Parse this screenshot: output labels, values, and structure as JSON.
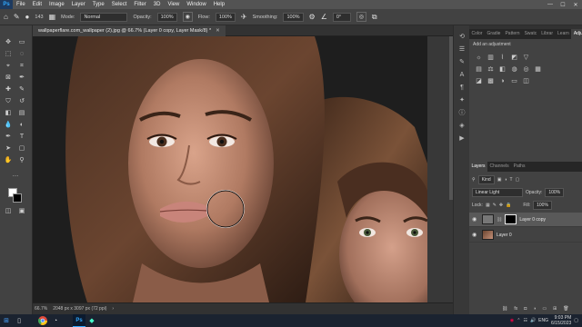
{
  "menubar": {
    "app_logo": "Ps",
    "items": [
      "File",
      "Edit",
      "Image",
      "Layer",
      "Type",
      "Select",
      "Filter",
      "3D",
      "View",
      "Window",
      "Help"
    ],
    "window_controls": [
      "—",
      "☐",
      "✕"
    ]
  },
  "options": {
    "brush_size": "143",
    "mode_label": "Mode:",
    "mode_value": "Normal",
    "opacity_label": "Opacity:",
    "opacity_value": "100%",
    "flow_label": "Flow:",
    "flow_value": "100%",
    "smoothing_label": "Smoothing:",
    "smoothing_value": "100%",
    "angle_value": "0°"
  },
  "document": {
    "tab_title": "wallpaperflare.com_wallpaper (2).jpg @ 66.7% (Layer 0 copy, Layer Mask/8) *",
    "zoom": "66.7%",
    "doc_info": "2048 px x 3097 px (72 ppi)"
  },
  "panels": {
    "top_tabs": [
      "Color",
      "Gradie",
      "Pattern",
      "Swatc",
      "Librar",
      "Learn",
      "Adjustments"
    ],
    "active_top_tab": "Adjustments",
    "add_adjustment_label": "Add an adjustment",
    "layers_tabs": [
      "Layers",
      "Channels",
      "Paths"
    ],
    "filter_kind": "Kind",
    "blend_mode": "Linear Light",
    "opacity_label": "Opacity:",
    "opacity_value": "100%",
    "lock_label": "Lock:",
    "fill_label": "Fill:",
    "fill_value": "100%",
    "layers": [
      {
        "name": "Layer 0 copy",
        "selected": true,
        "has_mask": true
      },
      {
        "name": "Layer 0",
        "selected": false,
        "has_mask": false
      }
    ]
  },
  "taskbar": {
    "time": "9:03 PM",
    "date": "6/15/2023",
    "lang": "ENG"
  },
  "colors": {
    "accent_blue": "#31a8ff",
    "panel_bg": "#424242",
    "menubar_bg": "#535353"
  }
}
